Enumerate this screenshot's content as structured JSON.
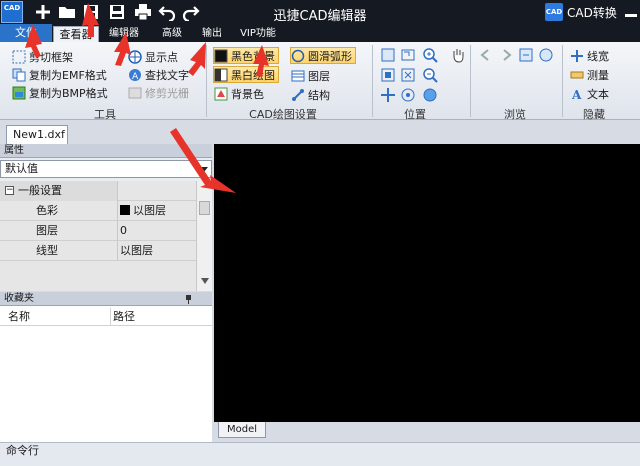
{
  "app": {
    "title": "迅捷CAD编辑器",
    "logo_text": "CAD",
    "convert_label": "CAD转换"
  },
  "menu": {
    "file": "文件",
    "tabs": [
      "查看器",
      "编辑器",
      "高级",
      "输出",
      "VIP功能"
    ],
    "active_tab": "查看器"
  },
  "ribbon": {
    "tools": {
      "title": "工具",
      "clip_copy": "剪切框架",
      "copy_emf": "复制为EMF格式",
      "copy_bmp": "复制为BMP格式",
      "show_points": "显示点",
      "find_text": "查找文字",
      "trim_raster": "修剪光栅"
    },
    "cad_settings": {
      "title": "CAD绘图设置",
      "black_bg": "黑色背景",
      "bw_drawing": "黑白绘图",
      "bg_color": "背景色",
      "smooth_arc": "圆滑弧形",
      "layers": "图层",
      "structure": "结构"
    },
    "position": {
      "title": "位置"
    },
    "browse": {
      "title": "浏览"
    },
    "hide": {
      "title": "隐藏",
      "line_width": "线宽",
      "measure": "测量",
      "text": "文本"
    }
  },
  "document": {
    "tab": "New1.dxf"
  },
  "properties": {
    "header": "属性",
    "selected": "默认值",
    "category": "一般设置",
    "rows": [
      {
        "key": "色彩",
        "value": "以图层"
      },
      {
        "key": "图层",
        "value": "0"
      },
      {
        "key": "线型",
        "value": "以图层"
      }
    ]
  },
  "favorites": {
    "header": "收藏夹",
    "columns": [
      "名称",
      "路径"
    ]
  },
  "canvas": {
    "background": "#000000",
    "model_tab": "Model"
  },
  "command": {
    "label": "命令行"
  },
  "colors": {
    "accent": "#2b72c9",
    "highlight": "#ffd36a",
    "annotation_arrow": "#e8332a"
  }
}
